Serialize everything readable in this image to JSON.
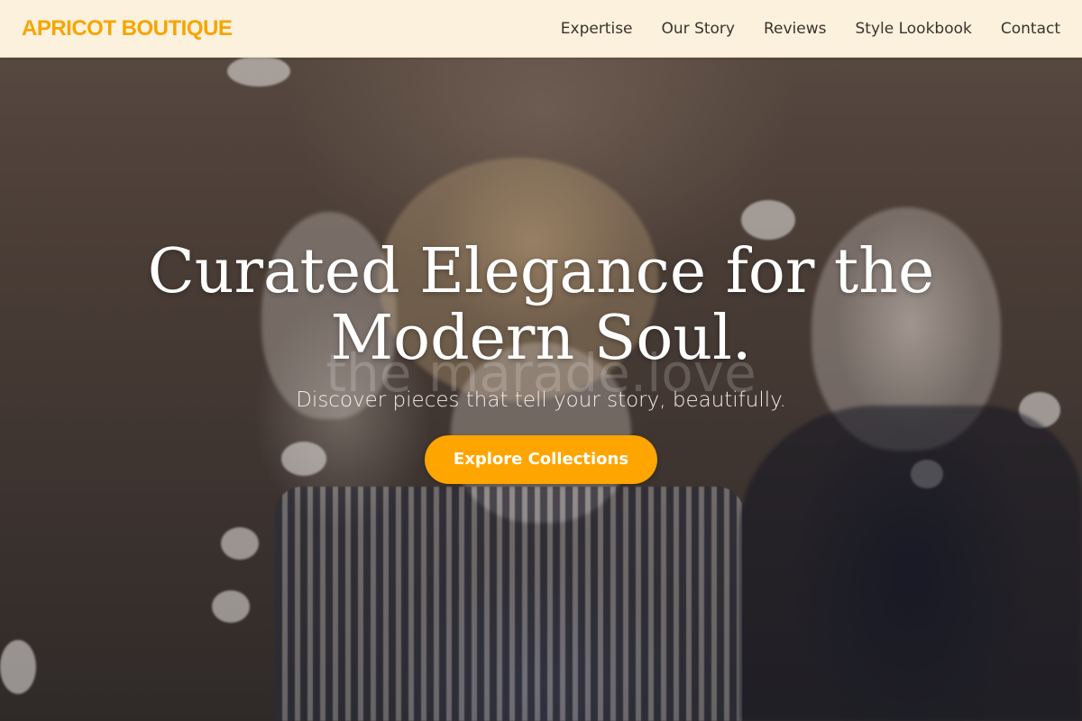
{
  "navbar": {
    "brand": "APRICOT BOUTIQUE",
    "links": [
      "Expertise",
      "Our Story",
      "Reviews",
      "Style Lookbook",
      "Contact"
    ]
  },
  "hero": {
    "headline_line1": "Curated Elegance for the",
    "headline_line2": "Modern Soul.",
    "subheadline": "Discover pieces that tell your story, beautifully.",
    "cta_label": "Explore Collections",
    "watermark": "the marade.love",
    "background_image": "store mannequins photo"
  },
  "colors": {
    "brand": "#f6a500",
    "navbar_bg": "#fbf1dc",
    "cta_bg": "#ffa500",
    "headline": "#ffffff"
  }
}
